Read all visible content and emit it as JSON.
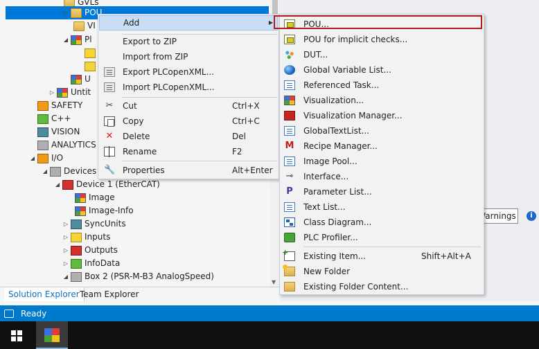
{
  "tree": {
    "items": [
      {
        "label": "GVLs",
        "icon": "folder-icon"
      },
      {
        "label": "POU",
        "icon": "folder-icon"
      },
      {
        "label": "VI",
        "icon": "folder-icon"
      },
      {
        "label": "Pl",
        "icon": "plc-icon"
      },
      {
        "label": "",
        "icon": "task-icon"
      },
      {
        "label": "",
        "icon": "task-icon"
      },
      {
        "label": "U",
        "icon": "plc-icon"
      },
      {
        "label": "Untit",
        "icon": "plc-project-icon"
      },
      {
        "label": "SAFETY",
        "icon": "safety-icon"
      },
      {
        "label": "C++",
        "icon": "cpp-icon"
      },
      {
        "label": "VISION",
        "icon": "vision-icon"
      },
      {
        "label": "ANALYTICS",
        "icon": "analytics-icon"
      },
      {
        "label": "I/O",
        "icon": "io-icon"
      },
      {
        "label": "Devices",
        "icon": "devices-icon"
      },
      {
        "label": "Device 1 (EtherCAT)",
        "icon": "ethercat-icon"
      },
      {
        "label": "Image",
        "icon": "image-icon"
      },
      {
        "label": "Image-Info",
        "icon": "image-info-icon"
      },
      {
        "label": "SyncUnits",
        "icon": "syncunits-icon"
      },
      {
        "label": "Inputs",
        "icon": "inputs-icon"
      },
      {
        "label": "Outputs",
        "icon": "outputs-icon"
      },
      {
        "label": "InfoData",
        "icon": "infodata-icon"
      },
      {
        "label": "Box 2 (PSR-M-B3 AnalogSpeed)",
        "icon": "box-icon"
      }
    ]
  },
  "tabs": [
    {
      "label": "Solution Explorer"
    },
    {
      "label": "Team Explorer"
    }
  ],
  "right_panel": {
    "warnings_label": "Warnings",
    "info_glyph": "i"
  },
  "status": {
    "text": "Ready"
  },
  "context_menu": {
    "items": [
      {
        "label": "Add",
        "shortcut": "",
        "icon": "",
        "submenu": true
      },
      {
        "label": "Export to ZIP",
        "shortcut": "",
        "icon": ""
      },
      {
        "label": "Import from ZIP",
        "shortcut": "",
        "icon": ""
      },
      {
        "label": "Export PLCopenXML...",
        "shortcut": "",
        "icon": "xml-export-icon"
      },
      {
        "label": "Import PLCopenXML...",
        "shortcut": "",
        "icon": "xml-import-icon"
      },
      {
        "label": "Cut",
        "shortcut": "Ctrl+X",
        "icon": "cut-icon"
      },
      {
        "label": "Copy",
        "shortcut": "Ctrl+C",
        "icon": "copy-icon"
      },
      {
        "label": "Delete",
        "shortcut": "Del",
        "icon": "delete-icon"
      },
      {
        "label": "Rename",
        "shortcut": "F2",
        "icon": "rename-icon"
      },
      {
        "label": "Properties",
        "shortcut": "Alt+Enter",
        "icon": "wrench-icon"
      }
    ]
  },
  "submenu": {
    "items": [
      {
        "label": "POU...",
        "shortcut": "",
        "icon": "pou-icon"
      },
      {
        "label": "POU for implicit checks...",
        "shortcut": "",
        "icon": "pou-checks-icon"
      },
      {
        "label": "DUT...",
        "shortcut": "",
        "icon": "dut-icon"
      },
      {
        "label": "Global Variable List...",
        "shortcut": "",
        "icon": "globe-icon"
      },
      {
        "label": "Referenced Task...",
        "shortcut": "",
        "icon": "task-icon"
      },
      {
        "label": "Visualization...",
        "shortcut": "",
        "icon": "visualization-icon"
      },
      {
        "label": "Visualization Manager...",
        "shortcut": "",
        "icon": "visualization-manager-icon"
      },
      {
        "label": "GlobalTextList...",
        "shortcut": "",
        "icon": "textlist-icon"
      },
      {
        "label": "Recipe Manager...",
        "shortcut": "",
        "icon": "recipe-icon"
      },
      {
        "label": "Image Pool...",
        "shortcut": "",
        "icon": "image-pool-icon"
      },
      {
        "label": "Interface...",
        "shortcut": "",
        "icon": "interface-icon"
      },
      {
        "label": "Parameter List...",
        "shortcut": "",
        "icon": "parameter-list-icon"
      },
      {
        "label": "Text List...",
        "shortcut": "",
        "icon": "text-list-icon"
      },
      {
        "label": "Class Diagram...",
        "shortcut": "",
        "icon": "class-diagram-icon"
      },
      {
        "label": "PLC Profiler...",
        "shortcut": "",
        "icon": "profiler-icon"
      },
      {
        "label": "Existing Item...",
        "shortcut": "Shift+Alt+A",
        "icon": "existing-item-icon"
      },
      {
        "label": "New Folder",
        "shortcut": "",
        "icon": "new-folder-icon"
      },
      {
        "label": "Existing Folder Content...",
        "shortcut": "",
        "icon": "folder-icon"
      }
    ]
  },
  "colors": {
    "accent": "#007acc",
    "selection": "#0078d7",
    "highlight_box": "#c0141c",
    "menu_hover": "#c9def5"
  }
}
